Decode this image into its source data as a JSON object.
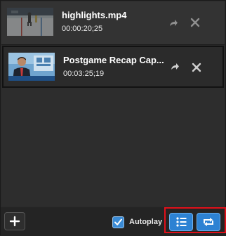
{
  "playlist": {
    "items": [
      {
        "title": "highlights.mp4",
        "duration": "00:00:20;25",
        "thumbnail_icon": "hockey-rink-thumbnail",
        "share_icon": "share-arrow-icon",
        "remove_icon": "close-icon"
      },
      {
        "title": "Postgame Recap Cap...",
        "duration": "00:03:25;19",
        "thumbnail_icon": "news-anchor-thumbnail",
        "share_icon": "share-arrow-icon",
        "remove_icon": "close-icon"
      }
    ]
  },
  "toolbar": {
    "add_icon": "plus-icon",
    "autoplay_label": "Autoplay",
    "autoplay_checked": true,
    "list_icon": "list-icon",
    "loop_icon": "loop-icon"
  },
  "colors": {
    "accent": "#2d82d3",
    "highlight": "#e0101a",
    "background": "#2b2b2b"
  }
}
